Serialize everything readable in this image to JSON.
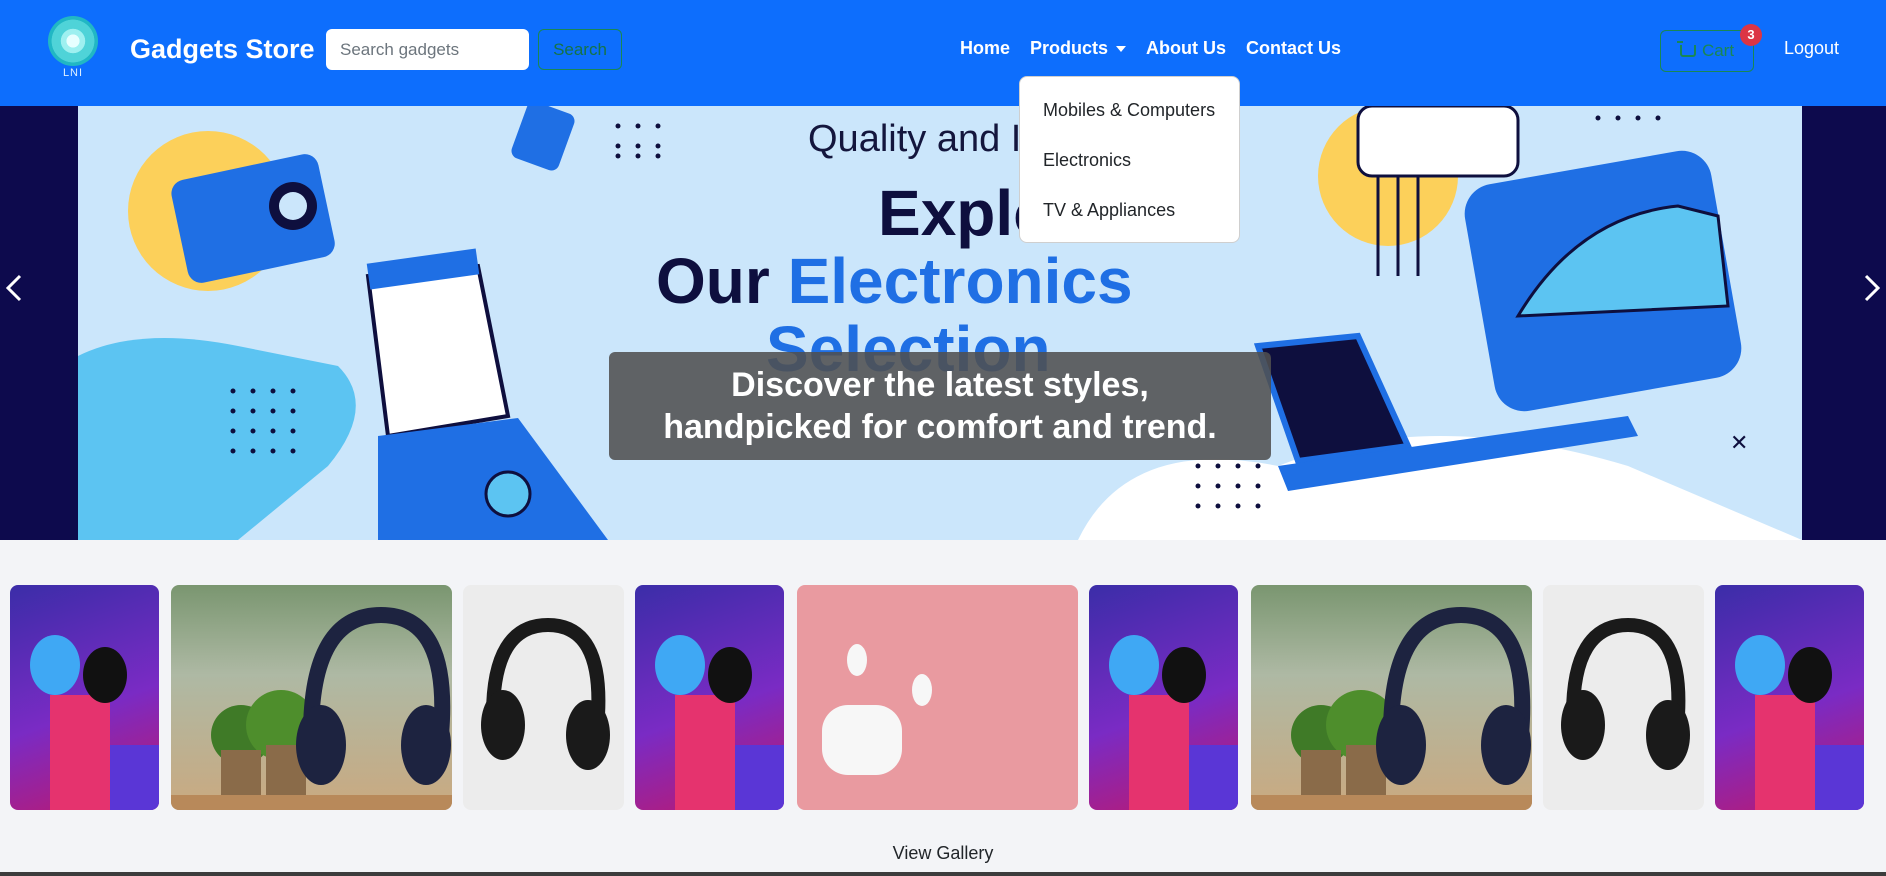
{
  "navbar": {
    "logo_text": "LNI",
    "brand": "Gadgets Store",
    "search_placeholder": "Search gadgets",
    "search_button": "Search",
    "links": [
      "Home",
      "Products",
      "About Us",
      "Contact Us"
    ],
    "products_dropdown": [
      "Mobiles & Computers",
      "Electronics",
      "TV & Appliances"
    ],
    "cart_label": "Cart",
    "cart_count": "3",
    "logout": "Logout"
  },
  "hero": {
    "banner_line1": "Quality and Inno",
    "banner_line2": "Explor",
    "banner_line3_a": "Our ",
    "banner_line3_b": "Electronics",
    "banner_line4": "Selection",
    "caption_line1": "Discover the latest styles,",
    "caption_line2": "handpicked for comfort and trend."
  },
  "gallery": {
    "images": [
      "earbuds-image",
      "headphones-on-stand-image",
      "black-headphones-image",
      "earbuds-image",
      "airpods-image",
      "earbuds-image",
      "headphones-on-stand-image",
      "black-headphones-image",
      "earbuds-image"
    ],
    "view_label": "View Gallery"
  },
  "colors": {
    "primary": "#0d6efd",
    "success": "#198754",
    "danger": "#dc3545",
    "hero_bg": "#0d0a4d"
  }
}
